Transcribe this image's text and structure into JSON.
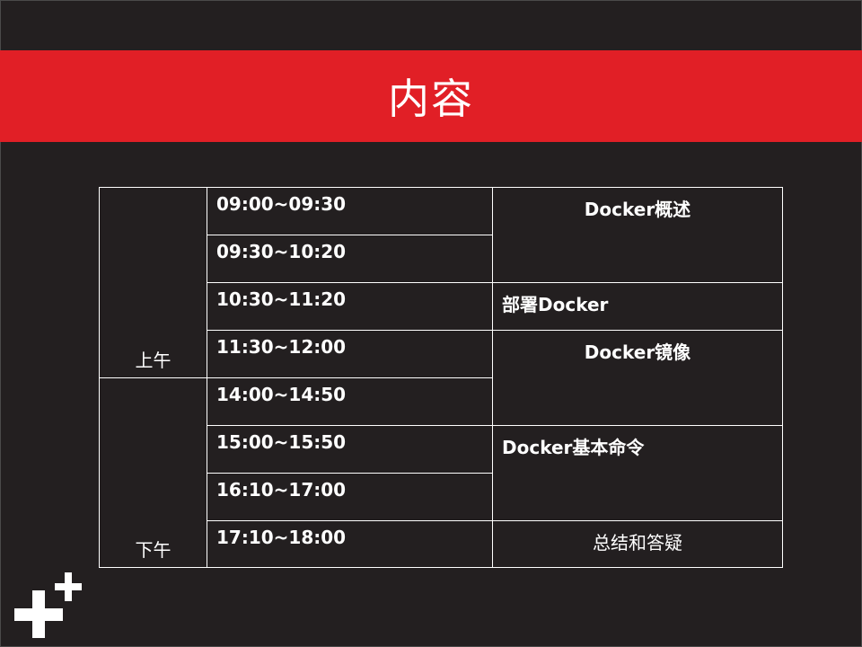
{
  "title": "内容",
  "schedule": {
    "periods": {
      "morning": "上午",
      "afternoon": "下午"
    },
    "times": [
      "09:00~09:30",
      "09:30~10:20",
      "10:30~11:20",
      "11:30~12:00",
      "14:00~14:50",
      "15:00~15:50",
      "16:10~17:00",
      "17:10~18:00"
    ],
    "topics": {
      "overview": "Docker概述",
      "deploy": "部署Docker",
      "images": "Docker镜像",
      "commands": "Docker基本命令",
      "summary": "总结和答疑"
    }
  },
  "colors": {
    "background": "#231f20",
    "accent": "#e11f26",
    "text": "#ffffff"
  },
  "icons": {
    "logo": "plus-logo-icon"
  }
}
